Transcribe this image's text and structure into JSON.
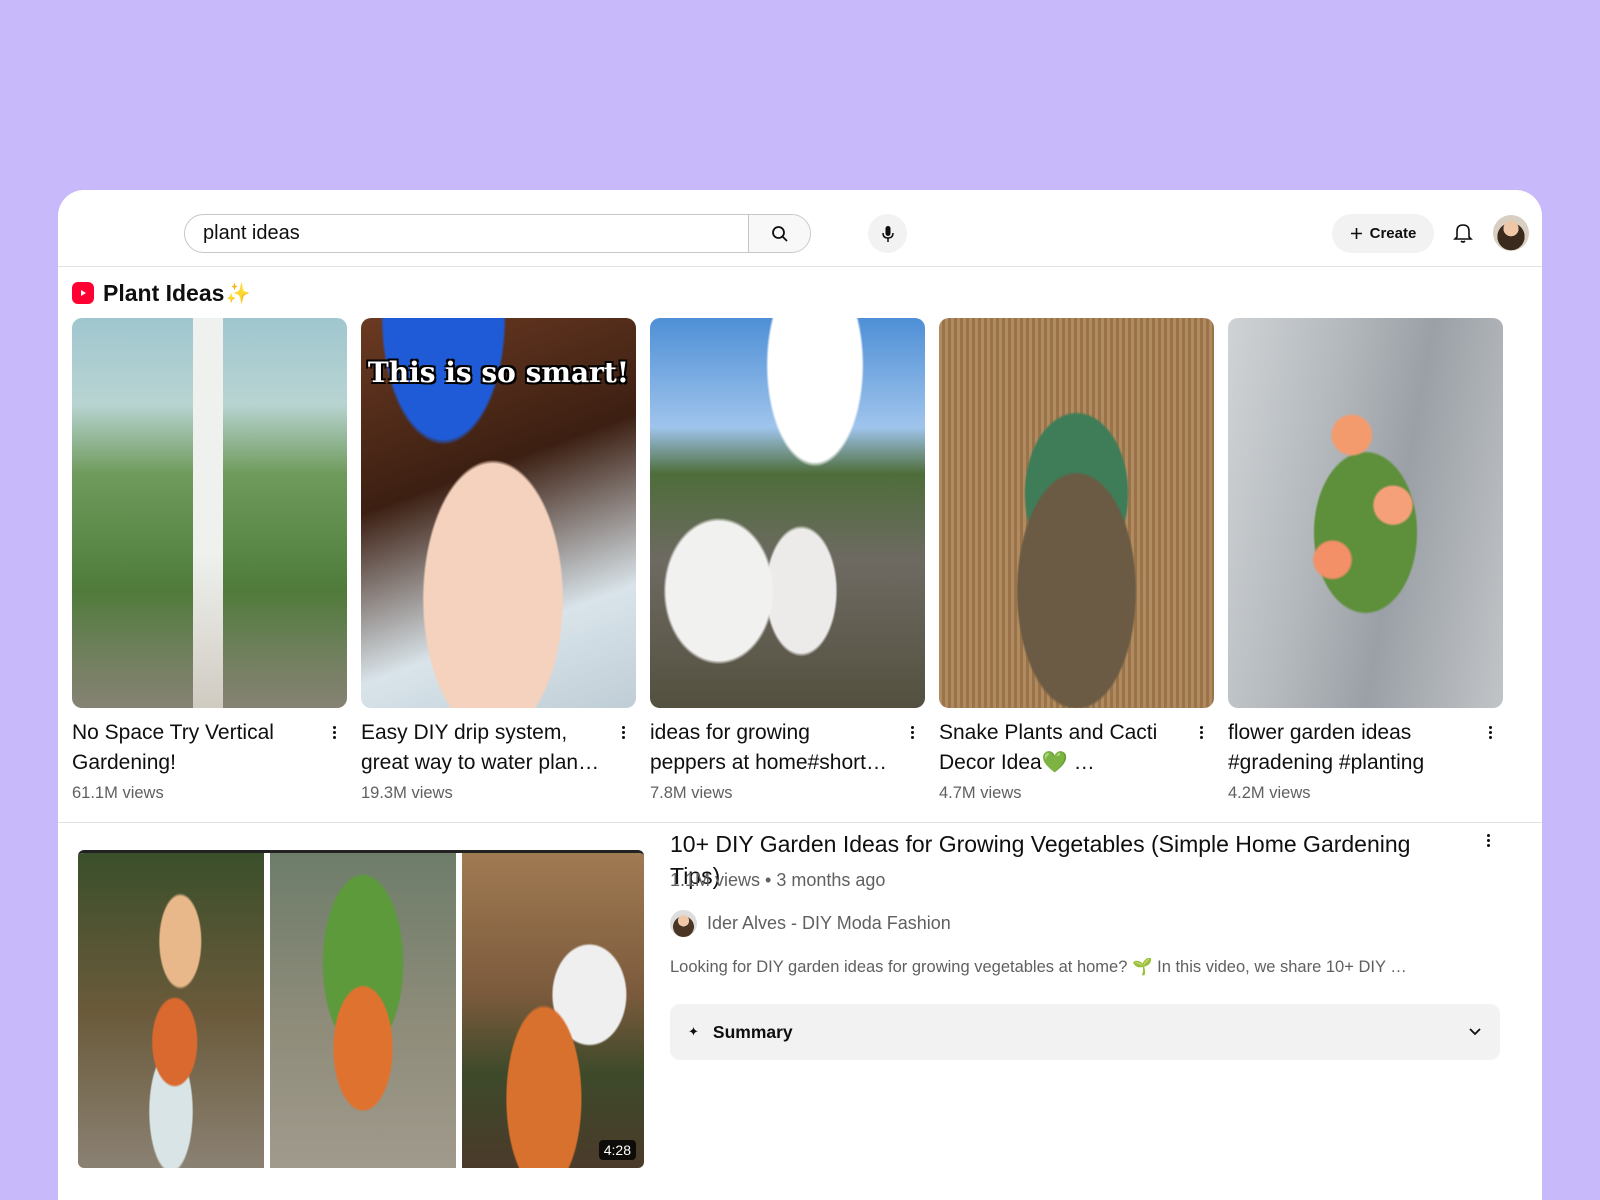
{
  "search": {
    "query": "plant ideas"
  },
  "header": {
    "create_label": "Create"
  },
  "shorts": {
    "title": "Plant Ideas",
    "sparkle": "✨",
    "items": [
      {
        "title": "No Space Try Vertical Gardening!",
        "views": "61.1M views"
      },
      {
        "title": "Easy DIY drip system, great way to water plan…",
        "views": "19.3M views",
        "overlay": "This is so smart!"
      },
      {
        "title": "ideas for growing peppers at home#short…",
        "views": "7.8M views"
      },
      {
        "title": "Snake Plants and Cacti Decor Idea💚 …",
        "views": "4.7M views"
      },
      {
        "title": "flower garden ideas #gradening #planting",
        "views": "4.2M views"
      }
    ]
  },
  "video": {
    "title": "10+ DIY Garden Ideas for Growing Vegetables (Simple Home Gardening Tips)",
    "meta": "1.1M views • 3 months ago",
    "channel": "Ider Alves - DIY Moda Fashion",
    "description": "Looking for DIY garden ideas for growing vegetables at home? 🌱 In this video, we share 10+ DIY …",
    "duration": "4:28",
    "summary_label": "Summary"
  },
  "colors": {
    "background": "#c8b9fb",
    "accent_red": "#ff0033"
  }
}
